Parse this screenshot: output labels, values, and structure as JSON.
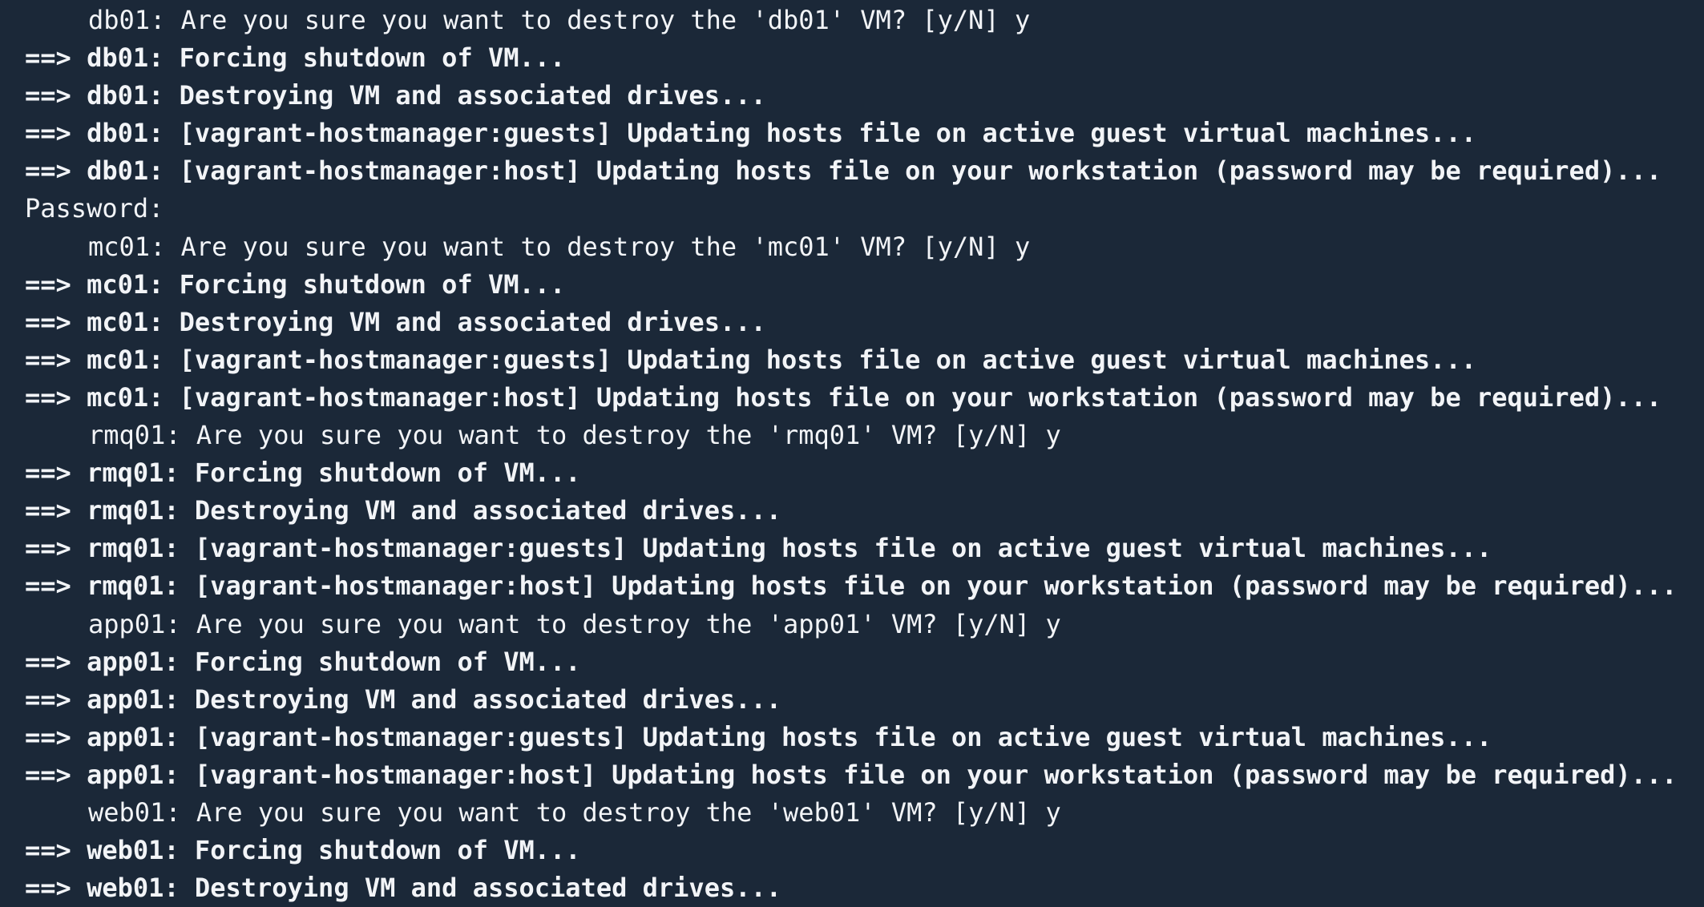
{
  "terminal": {
    "lines": [
      {
        "kind": "prompt",
        "text": "db01: Are you sure you want to destroy the 'db01' VM? [y/N] y"
      },
      {
        "kind": "status",
        "arrow": "==>",
        "text": "db01: Forcing shutdown of VM..."
      },
      {
        "kind": "status",
        "arrow": "==>",
        "text": "db01: Destroying VM and associated drives..."
      },
      {
        "kind": "status",
        "arrow": "==>",
        "text": "db01: [vagrant-hostmanager:guests] Updating hosts file on active guest virtual machines..."
      },
      {
        "kind": "status",
        "arrow": "==>",
        "text": "db01: [vagrant-hostmanager:host] Updating hosts file on your workstation (password may be required)..."
      },
      {
        "kind": "plain",
        "text": "Password:"
      },
      {
        "kind": "prompt",
        "text": "mc01: Are you sure you want to destroy the 'mc01' VM? [y/N] y"
      },
      {
        "kind": "status",
        "arrow": "==>",
        "text": "mc01: Forcing shutdown of VM..."
      },
      {
        "kind": "status",
        "arrow": "==>",
        "text": "mc01: Destroying VM and associated drives..."
      },
      {
        "kind": "status",
        "arrow": "==>",
        "text": "mc01: [vagrant-hostmanager:guests] Updating hosts file on active guest virtual machines..."
      },
      {
        "kind": "status",
        "arrow": "==>",
        "text": "mc01: [vagrant-hostmanager:host] Updating hosts file on your workstation (password may be required)..."
      },
      {
        "kind": "prompt",
        "text": "rmq01: Are you sure you want to destroy the 'rmq01' VM? [y/N] y"
      },
      {
        "kind": "status",
        "arrow": "==>",
        "text": "rmq01: Forcing shutdown of VM..."
      },
      {
        "kind": "status",
        "arrow": "==>",
        "text": "rmq01: Destroying VM and associated drives..."
      },
      {
        "kind": "status",
        "arrow": "==>",
        "text": "rmq01: [vagrant-hostmanager:guests] Updating hosts file on active guest virtual machines..."
      },
      {
        "kind": "status",
        "arrow": "==>",
        "text": "rmq01: [vagrant-hostmanager:host] Updating hosts file on your workstation (password may be required)..."
      },
      {
        "kind": "prompt",
        "text": "app01: Are you sure you want to destroy the 'app01' VM? [y/N] y"
      },
      {
        "kind": "status",
        "arrow": "==>",
        "text": "app01: Forcing shutdown of VM..."
      },
      {
        "kind": "status",
        "arrow": "==>",
        "text": "app01: Destroying VM and associated drives..."
      },
      {
        "kind": "status",
        "arrow": "==>",
        "text": "app01: [vagrant-hostmanager:guests] Updating hosts file on active guest virtual machines..."
      },
      {
        "kind": "status",
        "arrow": "==>",
        "text": "app01: [vagrant-hostmanager:host] Updating hosts file on your workstation (password may be required)..."
      },
      {
        "kind": "prompt",
        "text": "web01: Are you sure you want to destroy the 'web01' VM? [y/N] y"
      },
      {
        "kind": "status",
        "arrow": "==>",
        "text": "web01: Forcing shutdown of VM..."
      },
      {
        "kind": "status",
        "arrow": "==>",
        "text": "web01: Destroying VM and associated drives..."
      }
    ]
  },
  "colors": {
    "background": "#1b2838",
    "foreground": "#f2f4f7"
  }
}
